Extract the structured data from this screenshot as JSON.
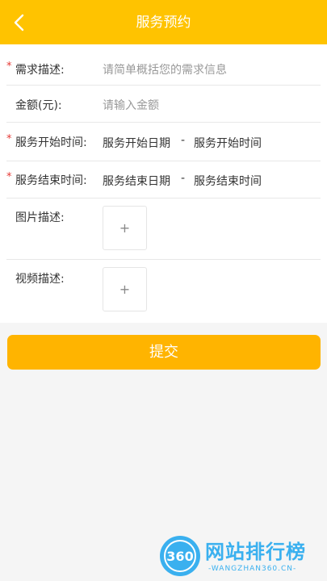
{
  "header": {
    "title": "服务预约",
    "back_icon": "chevron-left-icon"
  },
  "form": {
    "required_mark": "*",
    "demand": {
      "label": "需求描述:",
      "placeholder": "请简单概括您的需求信息"
    },
    "amount": {
      "label": "金额(元):",
      "placeholder": "请输入金额"
    },
    "start_time": {
      "label": "服务开始时间:",
      "date": "服务开始日期",
      "separator": "-",
      "time": "服务开始时间"
    },
    "end_time": {
      "label": "服务结束时间:",
      "date": "服务结束日期",
      "separator": "-",
      "time": "服务结束时间"
    },
    "image": {
      "label": "图片描述:",
      "add": "+"
    },
    "video": {
      "label": "视频描述:",
      "add": "+"
    }
  },
  "submit_label": "提交",
  "watermark": {
    "logo_text": "360",
    "title": "网站排行榜",
    "subtitle": "-WANGZHAN360.CN-"
  },
  "colors": {
    "header": "#ffc300",
    "button": "#ffb400",
    "required": "#e53935",
    "watermark": "#3ab0ef"
  }
}
